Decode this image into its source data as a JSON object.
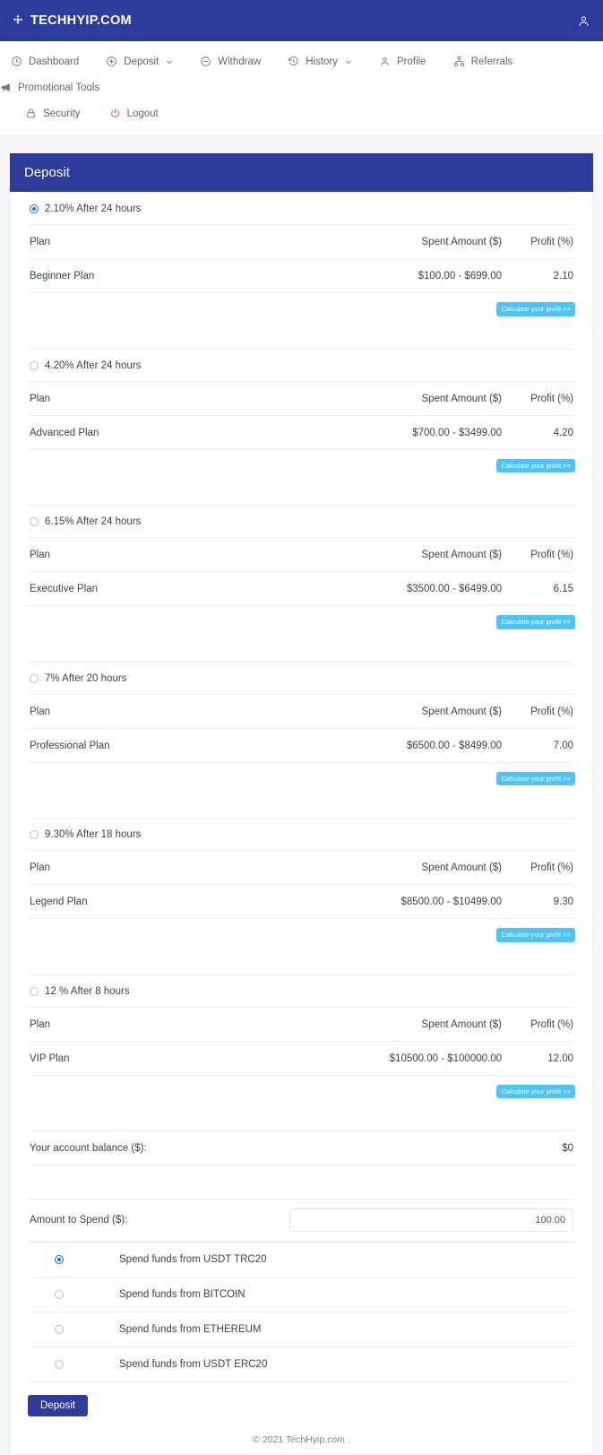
{
  "brand": {
    "name": "TECHHYIP.COM",
    "logo_icon": "move-arrows-icon",
    "account_icon": "user-icon",
    "bar_color": "#2d3c9b"
  },
  "nav": {
    "row1": [
      {
        "label": "Dashboard",
        "icon": "clock-icon",
        "caret": false
      },
      {
        "label": "Deposit",
        "icon": "plus-circle-icon",
        "caret": true
      },
      {
        "label": "Withdraw",
        "icon": "minus-circle-icon",
        "caret": false
      },
      {
        "label": "History",
        "icon": "history-icon",
        "caret": true
      },
      {
        "label": "Profile",
        "icon": "user-icon",
        "caret": false
      },
      {
        "label": "Referrals",
        "icon": "sitemap-icon",
        "caret": false
      },
      {
        "label": "Promotional Tools",
        "icon": "megaphone-icon",
        "caret": false
      }
    ],
    "row2": [
      {
        "label": "Security",
        "icon": "lock-icon",
        "caret": false
      },
      {
        "label": "Logout",
        "icon": "power-icon",
        "caret": false
      }
    ]
  },
  "card": {
    "title": "Deposit",
    "table_headers": {
      "plan": "Plan",
      "spent": "Spent Amount ($)",
      "profit": "Profit (%)"
    },
    "calculate_label": "Calculate your profit >>",
    "calculate_color": "#4fc3f7",
    "plans": [
      {
        "option": "2.10% After 24 hours",
        "selected": true,
        "name": "Beginner Plan",
        "spent": "$100.00 - $699.00",
        "profit": "2.10"
      },
      {
        "option": "4.20% After 24 hours",
        "selected": false,
        "name": "Advanced Plan",
        "spent": "$700.00 - $3499.00",
        "profit": "4.20"
      },
      {
        "option": "6.15% After 24 hours",
        "selected": false,
        "name": "Executive Plan",
        "spent": "$3500.00 - $6499.00",
        "profit": "6.15"
      },
      {
        "option": "7% After 20 hours",
        "selected": false,
        "name": "Professional Plan",
        "spent": "$6500.00 - $8499.00",
        "profit": "7.00"
      },
      {
        "option": "9.30% After 18 hours",
        "selected": false,
        "name": "Legend Plan",
        "spent": "$8500.00 - $10499.00",
        "profit": "9.30"
      },
      {
        "option": "12 % After 8 hours",
        "selected": false,
        "name": "VIP Plan",
        "spent": "$10500.00 - $100000.00",
        "profit": "12.00"
      }
    ],
    "balance": {
      "label": "Your account balance ($):",
      "value": "$0"
    },
    "amount": {
      "label": "Amount to Spend ($):",
      "value": "100.00",
      "placeholder": ""
    },
    "payment_methods": [
      {
        "label": "Spend funds from USDT TRC20",
        "selected": true
      },
      {
        "label": "Spend funds from BITCOIN",
        "selected": false
      },
      {
        "label": "Spend funds from ETHEREUM",
        "selected": false
      },
      {
        "label": "Spend funds from USDT ERC20",
        "selected": false
      }
    ],
    "submit_label": "Deposit"
  },
  "footer": {
    "text": "© 2021 TechHyip.com ."
  }
}
